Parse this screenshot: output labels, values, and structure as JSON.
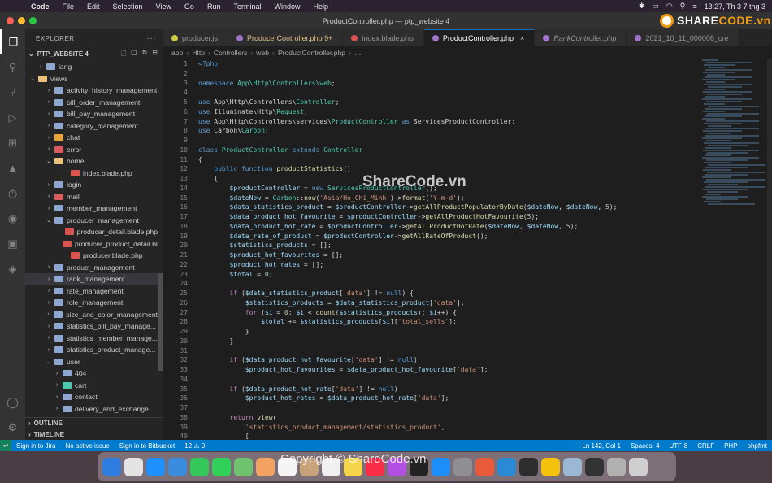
{
  "menubar": {
    "app": "Code",
    "items": [
      "File",
      "Edit",
      "Selection",
      "View",
      "Go",
      "Run",
      "Terminal",
      "Window",
      "Help"
    ],
    "clock": "13:27, Th 3 7 thg 3"
  },
  "window": {
    "title": "ProductController.php — ptp_website 4"
  },
  "logo": {
    "text_main": "SHARE",
    "text_accent": "CODE.vn"
  },
  "sidebar": {
    "header": "EXPLORER",
    "more": "···",
    "project": "PTP_WEBSITE 4",
    "tree": [
      {
        "label": "lang",
        "chev": "›",
        "indent": 14,
        "color": "#8ea7d1"
      },
      {
        "label": "views",
        "chev": "⌄",
        "indent": 4,
        "color": "#e8c27a"
      },
      {
        "label": "activity_history_management",
        "chev": "›",
        "indent": 24,
        "color": "#8ea7d1"
      },
      {
        "label": "bill_order_management",
        "chev": "›",
        "indent": 24,
        "color": "#8ea7d1"
      },
      {
        "label": "bill_pay_management",
        "chev": "›",
        "indent": 24,
        "color": "#8ea7d1"
      },
      {
        "label": "category_management",
        "chev": "›",
        "indent": 24,
        "color": "#8ea7d1"
      },
      {
        "label": "chat",
        "chev": "›",
        "indent": 24,
        "color": "#e8a33d"
      },
      {
        "label": "error",
        "chev": "›",
        "indent": 24,
        "color": "#d95b5b"
      },
      {
        "label": "home",
        "chev": "⌄",
        "indent": 24,
        "color": "#e8c27a"
      },
      {
        "label": "index.blade.php",
        "chev": "",
        "indent": 44,
        "color": "#d9534f"
      },
      {
        "label": "login",
        "chev": "›",
        "indent": 24,
        "color": "#8ea7d1"
      },
      {
        "label": "mail",
        "chev": "›",
        "indent": 24,
        "color": "#d95b5b"
      },
      {
        "label": "member_management",
        "chev": "›",
        "indent": 24,
        "color": "#8ea7d1"
      },
      {
        "label": "producer_management",
        "chev": "⌄",
        "indent": 24,
        "color": "#8ea7d1"
      },
      {
        "label": "producer_detail.blade.php",
        "chev": "",
        "indent": 44,
        "color": "#d9534f"
      },
      {
        "label": "producer_product_detail.bl...",
        "chev": "",
        "indent": 44,
        "color": "#d9534f"
      },
      {
        "label": "producer.blade.php",
        "chev": "",
        "indent": 44,
        "color": "#d9534f"
      },
      {
        "label": "product_management",
        "chev": "›",
        "indent": 24,
        "color": "#8ea7d1"
      },
      {
        "label": "rank_management",
        "chev": "›",
        "indent": 24,
        "color": "#8ea7d1",
        "selected": true
      },
      {
        "label": "rate_management",
        "chev": "›",
        "indent": 24,
        "color": "#8ea7d1"
      },
      {
        "label": "role_management",
        "chev": "›",
        "indent": 24,
        "color": "#8ea7d1"
      },
      {
        "label": "size_and_color_management",
        "chev": "›",
        "indent": 24,
        "color": "#8ea7d1"
      },
      {
        "label": "statistics_bill_pay_manage...",
        "chev": "›",
        "indent": 24,
        "color": "#8ea7d1"
      },
      {
        "label": "statistics_member_manage...",
        "chev": "›",
        "indent": 24,
        "color": "#8ea7d1"
      },
      {
        "label": "statistics_product_manage...",
        "chev": "›",
        "indent": 24,
        "color": "#8ea7d1"
      },
      {
        "label": "user",
        "chev": "⌄",
        "indent": 24,
        "color": "#8ea7d1"
      },
      {
        "label": "404",
        "chev": "›",
        "indent": 34,
        "color": "#8ea7d1"
      },
      {
        "label": "cart",
        "chev": "›",
        "indent": 34,
        "color": "#4ec9b0"
      },
      {
        "label": "contact",
        "chev": "›",
        "indent": 34,
        "color": "#8ea7d1"
      },
      {
        "label": "delivery_and_exchange",
        "chev": "›",
        "indent": 34,
        "color": "#8ea7d1"
      }
    ],
    "outline": "OUTLINE",
    "timeline": "TIMELINE"
  },
  "tabs": [
    {
      "label": "producer.js",
      "color": "#cbcb41",
      "style": "normal"
    },
    {
      "label": "ProducerController.php 9+",
      "color": "#a074c4",
      "style": "modified"
    },
    {
      "label": "index.blade.php",
      "color": "#d9534f",
      "style": "normal"
    },
    {
      "label": "ProductController.php",
      "color": "#a074c4",
      "style": "active"
    },
    {
      "label": "RankController.php",
      "color": "#a074c4",
      "style": "italic"
    },
    {
      "label": "2021_10_11_000008_cre",
      "color": "#a074c4",
      "style": "normal"
    }
  ],
  "breadcrumb": [
    "app",
    "Http",
    "Controllers",
    "web",
    "ProductController.php",
    "…"
  ],
  "code": {
    "start_line": 1,
    "lines": [
      [
        [
          "<?php",
          "#569cd6"
        ]
      ],
      [],
      [
        [
          "namespace ",
          "#569cd6"
        ],
        [
          "App\\Http\\Controllers\\web",
          "#4ec9b0"
        ],
        [
          ";",
          "#d4d4d4"
        ]
      ],
      [],
      [
        [
          "use ",
          "#569cd6"
        ],
        [
          "App\\Http\\Controllers\\",
          "#d4d4d4"
        ],
        [
          "Controller",
          "#4ec9b0"
        ],
        [
          ";",
          "#d4d4d4"
        ]
      ],
      [
        [
          "use ",
          "#569cd6"
        ],
        [
          "Illuminate\\Http\\",
          "#d4d4d4"
        ],
        [
          "Request",
          "#4ec9b0"
        ],
        [
          ";",
          "#d4d4d4"
        ]
      ],
      [
        [
          "use ",
          "#569cd6"
        ],
        [
          "App\\Http\\Controllers\\services\\",
          "#d4d4d4"
        ],
        [
          "ProductController",
          "#4ec9b0"
        ],
        [
          " as ",
          "#569cd6"
        ],
        [
          "ServicesProductController;",
          "#d4d4d4"
        ]
      ],
      [
        [
          "use ",
          "#569cd6"
        ],
        [
          "Carbon\\",
          "#d4d4d4"
        ],
        [
          "Carbon",
          "#4ec9b0"
        ],
        [
          ";",
          "#d4d4d4"
        ]
      ],
      [],
      [
        [
          "class ",
          "#569cd6"
        ],
        [
          "ProductController ",
          "#4ec9b0"
        ],
        [
          "extends ",
          "#569cd6"
        ],
        [
          "Controller",
          "#4ec9b0"
        ]
      ],
      [
        [
          "{",
          "#d4d4d4"
        ]
      ],
      [
        [
          "    public function ",
          "#569cd6"
        ],
        [
          "productStatistics",
          "#dcdcaa"
        ],
        [
          "()",
          "#d4d4d4"
        ]
      ],
      [
        [
          "    {",
          "#d4d4d4"
        ]
      ],
      [
        [
          "        $productController",
          "#9cdcfe"
        ],
        [
          " = ",
          "#d4d4d4"
        ],
        [
          "new ",
          "#569cd6"
        ],
        [
          "ServicesProductController",
          "#4ec9b0"
        ],
        [
          "();",
          "#d4d4d4"
        ]
      ],
      [
        [
          "        $dateNow",
          "#9cdcfe"
        ],
        [
          " = ",
          "#d4d4d4"
        ],
        [
          "Carbon",
          "#4ec9b0"
        ],
        [
          "::",
          "#d4d4d4"
        ],
        [
          "now",
          "#dcdcaa"
        ],
        [
          "(",
          "#d4d4d4"
        ],
        [
          "'Asia/Ho_Chi_Minh'",
          "#ce9178"
        ],
        [
          ")->",
          "#d4d4d4"
        ],
        [
          "format",
          "#dcdcaa"
        ],
        [
          "(",
          "#d4d4d4"
        ],
        [
          "'Y-m-d'",
          "#ce9178"
        ],
        [
          ");",
          "#d4d4d4"
        ]
      ],
      [
        [
          "        $data_statistics_product",
          "#9cdcfe"
        ],
        [
          " = ",
          "#d4d4d4"
        ],
        [
          "$productController",
          "#9cdcfe"
        ],
        [
          "->",
          "#d4d4d4"
        ],
        [
          "getAllProductPopulatorByDate",
          "#dcdcaa"
        ],
        [
          "(",
          "#d4d4d4"
        ],
        [
          "$dateNow",
          "#9cdcfe"
        ],
        [
          ", ",
          "#d4d4d4"
        ],
        [
          "$dateNow",
          "#9cdcfe"
        ],
        [
          ", ",
          "#d4d4d4"
        ],
        [
          "5",
          "#b5cea8"
        ],
        [
          ");",
          "#d4d4d4"
        ]
      ],
      [
        [
          "        $data_product_hot_favourite",
          "#9cdcfe"
        ],
        [
          " = ",
          "#d4d4d4"
        ],
        [
          "$productController",
          "#9cdcfe"
        ],
        [
          "->",
          "#d4d4d4"
        ],
        [
          "getAllProductHotFavourite",
          "#dcdcaa"
        ],
        [
          "(",
          "#d4d4d4"
        ],
        [
          "5",
          "#b5cea8"
        ],
        [
          ");",
          "#d4d4d4"
        ]
      ],
      [
        [
          "        $data_product_hot_rate",
          "#9cdcfe"
        ],
        [
          " = ",
          "#d4d4d4"
        ],
        [
          "$productController",
          "#9cdcfe"
        ],
        [
          "->",
          "#d4d4d4"
        ],
        [
          "getAllProductHotRate",
          "#dcdcaa"
        ],
        [
          "(",
          "#d4d4d4"
        ],
        [
          "$dateNow",
          "#9cdcfe"
        ],
        [
          ", ",
          "#d4d4d4"
        ],
        [
          "$dateNow",
          "#9cdcfe"
        ],
        [
          ", ",
          "#d4d4d4"
        ],
        [
          "5",
          "#b5cea8"
        ],
        [
          ");",
          "#d4d4d4"
        ]
      ],
      [
        [
          "        $data_rate_of_product",
          "#9cdcfe"
        ],
        [
          " = ",
          "#d4d4d4"
        ],
        [
          "$productController",
          "#9cdcfe"
        ],
        [
          "->",
          "#d4d4d4"
        ],
        [
          "getAllRateOfProduct",
          "#dcdcaa"
        ],
        [
          "();",
          "#d4d4d4"
        ]
      ],
      [
        [
          "        $statistics_products",
          "#9cdcfe"
        ],
        [
          " = [];",
          "#d4d4d4"
        ]
      ],
      [
        [
          "        $product_hot_favourites",
          "#9cdcfe"
        ],
        [
          " = [];",
          "#d4d4d4"
        ]
      ],
      [
        [
          "        $product_hot_rates",
          "#9cdcfe"
        ],
        [
          " = [];",
          "#d4d4d4"
        ]
      ],
      [
        [
          "        $total",
          "#9cdcfe"
        ],
        [
          " = ",
          "#d4d4d4"
        ],
        [
          "0",
          "#b5cea8"
        ],
        [
          ";",
          "#d4d4d4"
        ]
      ],
      [],
      [
        [
          "        if ",
          "#c586c0"
        ],
        [
          "(",
          "#d4d4d4"
        ],
        [
          "$data_statistics_product",
          "#9cdcfe"
        ],
        [
          "[",
          "#d4d4d4"
        ],
        [
          "'data'",
          "#ce9178"
        ],
        [
          "] != ",
          "#d4d4d4"
        ],
        [
          "null",
          "#569cd6"
        ],
        [
          ") {",
          "#d4d4d4"
        ]
      ],
      [
        [
          "            $statistics_products",
          "#9cdcfe"
        ],
        [
          " = ",
          "#d4d4d4"
        ],
        [
          "$data_statistics_product",
          "#9cdcfe"
        ],
        [
          "[",
          "#d4d4d4"
        ],
        [
          "'data'",
          "#ce9178"
        ],
        [
          "];",
          "#d4d4d4"
        ]
      ],
      [
        [
          "            for ",
          "#c586c0"
        ],
        [
          "(",
          "#d4d4d4"
        ],
        [
          "$i",
          "#9cdcfe"
        ],
        [
          " = ",
          "#d4d4d4"
        ],
        [
          "0",
          "#b5cea8"
        ],
        [
          "; ",
          "#d4d4d4"
        ],
        [
          "$i",
          "#9cdcfe"
        ],
        [
          " < ",
          "#d4d4d4"
        ],
        [
          "count",
          "#dcdcaa"
        ],
        [
          "(",
          "#d4d4d4"
        ],
        [
          "$statistics_products",
          "#9cdcfe"
        ],
        [
          "); ",
          "#d4d4d4"
        ],
        [
          "$i",
          "#9cdcfe"
        ],
        [
          "++) {",
          "#d4d4d4"
        ]
      ],
      [
        [
          "                $total",
          "#9cdcfe"
        ],
        [
          " += ",
          "#d4d4d4"
        ],
        [
          "$statistics_products",
          "#9cdcfe"
        ],
        [
          "[",
          "#d4d4d4"
        ],
        [
          "$i",
          "#9cdcfe"
        ],
        [
          "][",
          "#d4d4d4"
        ],
        [
          "'total_sells'",
          "#ce9178"
        ],
        [
          "];",
          "#d4d4d4"
        ]
      ],
      [
        [
          "            }",
          "#d4d4d4"
        ]
      ],
      [
        [
          "        }",
          "#d4d4d4"
        ]
      ],
      [],
      [
        [
          "        if ",
          "#c586c0"
        ],
        [
          "(",
          "#d4d4d4"
        ],
        [
          "$data_product_hot_favourite",
          "#9cdcfe"
        ],
        [
          "[",
          "#d4d4d4"
        ],
        [
          "'data'",
          "#ce9178"
        ],
        [
          "] != ",
          "#d4d4d4"
        ],
        [
          "null",
          "#569cd6"
        ],
        [
          ")",
          "#d4d4d4"
        ]
      ],
      [
        [
          "            $product_hot_favourites",
          "#9cdcfe"
        ],
        [
          " = ",
          "#d4d4d4"
        ],
        [
          "$data_product_hot_favourite",
          "#9cdcfe"
        ],
        [
          "[",
          "#d4d4d4"
        ],
        [
          "'data'",
          "#ce9178"
        ],
        [
          "];",
          "#d4d4d4"
        ]
      ],
      [],
      [
        [
          "        if ",
          "#c586c0"
        ],
        [
          "(",
          "#d4d4d4"
        ],
        [
          "$data_product_hot_rate",
          "#9cdcfe"
        ],
        [
          "[",
          "#d4d4d4"
        ],
        [
          "'data'",
          "#ce9178"
        ],
        [
          "] != ",
          "#d4d4d4"
        ],
        [
          "null",
          "#569cd6"
        ],
        [
          ")",
          "#d4d4d4"
        ]
      ],
      [
        [
          "            $product_hot_rates",
          "#9cdcfe"
        ],
        [
          " = ",
          "#d4d4d4"
        ],
        [
          "$data_product_hot_rate",
          "#9cdcfe"
        ],
        [
          "[",
          "#d4d4d4"
        ],
        [
          "'data'",
          "#ce9178"
        ],
        [
          "];",
          "#d4d4d4"
        ]
      ],
      [],
      [
        [
          "        return ",
          "#c586c0"
        ],
        [
          "view",
          "#dcdcaa"
        ],
        [
          "(",
          "#d4d4d4"
        ]
      ],
      [
        [
          "            'statistics_product_management/statistics_product'",
          "#ce9178"
        ],
        [
          ",",
          "#d4d4d4"
        ]
      ],
      [
        [
          "            [",
          "#d4d4d4"
        ]
      ]
    ]
  },
  "overlay": {
    "editor_watermark": "ShareCode.vn",
    "dock_watermark": "Copyright © ShareCode.vn"
  },
  "statusbar": {
    "left": [
      "Sign in to Jira",
      "No active issue",
      "Sign in to Bitbucket",
      "12 ⚠ 0"
    ],
    "right": [
      "Ln 142, Col 1",
      "Spaces: 4",
      "UTF-8",
      "CRLF",
      "PHP",
      "phpfmt"
    ]
  },
  "dock": {
    "apps": [
      {
        "name": "finder-icon",
        "color": "#2f7de1"
      },
      {
        "name": "launchpad-icon",
        "color": "#e4e4e4"
      },
      {
        "name": "safari-icon",
        "color": "#1e90ff"
      },
      {
        "name": "mail-icon",
        "color": "#3a8dde"
      },
      {
        "name": "facetime-icon",
        "color": "#34c759"
      },
      {
        "name": "messages-icon",
        "color": "#30d158"
      },
      {
        "name": "maps-icon",
        "color": "#6fc36f"
      },
      {
        "name": "photos-icon",
        "color": "#f4a261"
      },
      {
        "name": "calendar-icon",
        "color": "#f5f5f5"
      },
      {
        "name": "contacts-icon",
        "color": "#c8a27a"
      },
      {
        "name": "reminders-icon",
        "color": "#f0f0f0"
      },
      {
        "name": "notes-icon",
        "color": "#f5d547"
      },
      {
        "name": "music-icon",
        "color": "#fa2d48"
      },
      {
        "name": "podcasts-icon",
        "color": "#b150e2"
      },
      {
        "name": "tv-icon",
        "color": "#222222"
      },
      {
        "name": "app-store-icon",
        "color": "#1c8ef9"
      },
      {
        "name": "system-preferences-icon",
        "color": "#8e8e93"
      },
      {
        "name": "git-icon",
        "color": "#e85a3a"
      },
      {
        "name": "vscode-icon",
        "color": "#2a8ad6"
      },
      {
        "name": "terminal-app-icon",
        "color": "#2d2d2d"
      },
      {
        "name": "chrome-icon",
        "color": "#f4c20d"
      },
      {
        "name": "preview-icon",
        "color": "#9bb7d4"
      },
      {
        "name": "console-icon",
        "color": "#333333"
      },
      {
        "name": "utility-icon",
        "color": "#b0b0b0"
      },
      {
        "name": "trash-icon",
        "color": "#cfcfcf"
      }
    ]
  }
}
